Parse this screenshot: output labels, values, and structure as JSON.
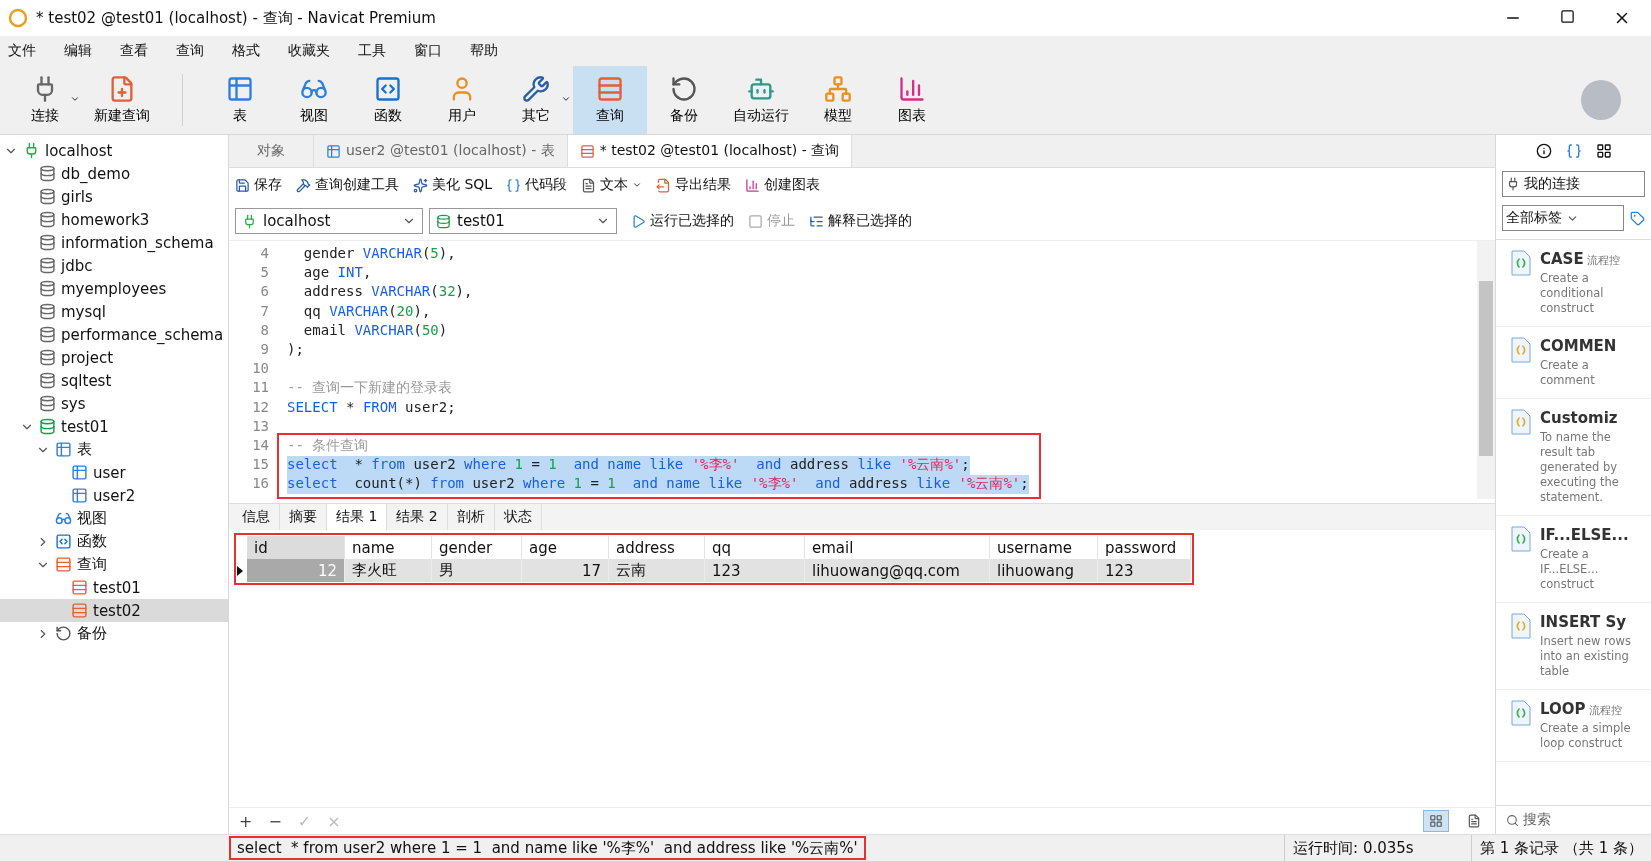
{
  "window": {
    "title": "* test02 @test01 (localhost) - 查询 - Navicat Premium"
  },
  "menu": [
    "文件",
    "编辑",
    "查看",
    "查询",
    "格式",
    "收藏夹",
    "工具",
    "窗口",
    "帮助"
  ],
  "toolbar": [
    {
      "label": "连接",
      "dropdown": true,
      "selected": false
    },
    {
      "label": "新建查询",
      "dropdown": false,
      "selected": false
    },
    {
      "label": "表",
      "dropdown": false,
      "selected": false
    },
    {
      "label": "视图",
      "dropdown": false,
      "selected": false
    },
    {
      "label": "函数",
      "dropdown": false,
      "selected": false
    },
    {
      "label": "用户",
      "dropdown": false,
      "selected": false
    },
    {
      "label": "其它",
      "dropdown": true,
      "selected": false
    },
    {
      "label": "查询",
      "dropdown": false,
      "selected": true
    },
    {
      "label": "备份",
      "dropdown": false,
      "selected": false
    },
    {
      "label": "自动运行",
      "dropdown": false,
      "selected": false
    },
    {
      "label": "模型",
      "dropdown": false,
      "selected": false
    },
    {
      "label": "图表",
      "dropdown": false,
      "selected": false
    }
  ],
  "sidebar": {
    "items": [
      {
        "label": "localhost",
        "kind": "connection",
        "expanded": true,
        "selected": false,
        "children": [
          {
            "label": "db_demo",
            "kind": "database",
            "selected": false
          },
          {
            "label": "girls",
            "kind": "database",
            "selected": false
          },
          {
            "label": "homework3",
            "kind": "database",
            "selected": false
          },
          {
            "label": "information_schema",
            "kind": "database",
            "selected": false
          },
          {
            "label": "jdbc",
            "kind": "database",
            "selected": false
          },
          {
            "label": "myemployees",
            "kind": "database",
            "selected": false
          },
          {
            "label": "mysql",
            "kind": "database",
            "selected": false
          },
          {
            "label": "performance_schema",
            "kind": "database",
            "selected": false
          },
          {
            "label": "project",
            "kind": "database",
            "selected": false
          },
          {
            "label": "sqltest",
            "kind": "database",
            "selected": false
          },
          {
            "label": "sys",
            "kind": "database",
            "selected": false
          },
          {
            "label": "test01",
            "kind": "opendatabase",
            "expanded": true,
            "selected": false,
            "children": [
              {
                "label": "表",
                "kind": "table",
                "expanded": true,
                "selected": false,
                "children": [
                  {
                    "label": "user",
                    "kind": "table",
                    "selected": false
                  },
                  {
                    "label": "user2",
                    "kind": "table",
                    "selected": false
                  }
                ]
              },
              {
                "label": "视图",
                "kind": "view",
                "selected": false
              },
              {
                "label": "函数",
                "kind": "function",
                "expanded": false,
                "selected": false
              },
              {
                "label": "查询",
                "kind": "query",
                "expanded": true,
                "selected": false,
                "children": [
                  {
                    "label": "test01",
                    "kind": "query",
                    "selected": false
                  },
                  {
                    "label": "test02",
                    "kind": "query",
                    "selected": true
                  }
                ]
              },
              {
                "label": "备份",
                "kind": "backup",
                "expanded": false,
                "selected": false
              }
            ]
          }
        ]
      }
    ]
  },
  "tabs": [
    {
      "label": "对象",
      "selected": false
    },
    {
      "label": "user2 @test01 (localhost) - 表",
      "selected": false
    },
    {
      "label": "* test02 @test01 (localhost) - 查询",
      "selected": true
    }
  ],
  "query_toolbar": [
    {
      "label": "保存",
      "dropdown": false
    },
    {
      "label": "查询创建工具",
      "dropdown": false
    },
    {
      "label": "美化 SQL",
      "dropdown": false
    },
    {
      "label": "代码段",
      "dropdown": false
    },
    {
      "label": "文本",
      "dropdown": true
    },
    {
      "label": "导出结果",
      "dropdown": false
    },
    {
      "label": "创建图表",
      "dropdown": false
    }
  ],
  "connection_select": {
    "value": "localhost"
  },
  "database_select": {
    "value": "test01"
  },
  "run_actions": [
    {
      "label": "运行已选择的",
      "disabled": false
    },
    {
      "label": "停止",
      "disabled": true
    },
    {
      "label": "解释已选择的",
      "disabled": false
    }
  ],
  "editor": {
    "highlighted": true,
    "lines": [
      {
        "number": "4",
        "selected": false,
        "tokens": [
          {
            "kind": "plain",
            "text": "  gender "
          },
          {
            "kind": "keyword",
            "text": "VARCHAR"
          },
          {
            "kind": "plain",
            "text": "("
          },
          {
            "kind": "number",
            "text": "5"
          },
          {
            "kind": "plain",
            "text": "),"
          }
        ]
      },
      {
        "number": "5",
        "selected": false,
        "tokens": [
          {
            "kind": "plain",
            "text": "  age "
          },
          {
            "kind": "keyword",
            "text": "INT"
          },
          {
            "kind": "plain",
            "text": ","
          }
        ]
      },
      {
        "number": "6",
        "selected": false,
        "tokens": [
          {
            "kind": "plain",
            "text": "  address "
          },
          {
            "kind": "keyword",
            "text": "VARCHAR"
          },
          {
            "kind": "plain",
            "text": "("
          },
          {
            "kind": "number",
            "text": "32"
          },
          {
            "kind": "plain",
            "text": "),"
          }
        ]
      },
      {
        "number": "7",
        "selected": false,
        "tokens": [
          {
            "kind": "plain",
            "text": "  qq "
          },
          {
            "kind": "keyword",
            "text": "VARCHAR"
          },
          {
            "kind": "plain",
            "text": "("
          },
          {
            "kind": "number",
            "text": "20"
          },
          {
            "kind": "plain",
            "text": "),"
          }
        ]
      },
      {
        "number": "8",
        "selected": false,
        "tokens": [
          {
            "kind": "plain",
            "text": "  email "
          },
          {
            "kind": "keyword",
            "text": "VARCHAR"
          },
          {
            "kind": "plain",
            "text": "("
          },
          {
            "kind": "number",
            "text": "50"
          },
          {
            "kind": "plain",
            "text": ")"
          }
        ]
      },
      {
        "number": "9",
        "selected": false,
        "tokens": [
          {
            "kind": "plain",
            "text": ");"
          }
        ]
      },
      {
        "number": "10",
        "selected": false
      },
      {
        "number": "11",
        "selected": false,
        "tokens": [
          {
            "kind": "comment",
            "text": "-- 查询一下新建的登录表"
          }
        ]
      },
      {
        "number": "12",
        "selected": false,
        "tokens": [
          {
            "kind": "keyword",
            "text": "SELECT"
          },
          {
            "kind": "plain",
            "text": " * "
          },
          {
            "kind": "keyword",
            "text": "FROM"
          },
          {
            "kind": "plain",
            "text": " user2;"
          }
        ]
      },
      {
        "number": "13",
        "selected": false
      },
      {
        "number": "14",
        "selected": false,
        "tokens": [
          {
            "kind": "comment",
            "text": "-- 条件查询"
          }
        ]
      },
      {
        "number": "15",
        "selected": true,
        "tokens": [
          {
            "kind": "keyword",
            "text": "select"
          },
          {
            "kind": "plain",
            "text": "  * "
          },
          {
            "kind": "keyword",
            "text": "from"
          },
          {
            "kind": "plain",
            "text": " user2 "
          },
          {
            "kind": "keyword",
            "text": "where"
          },
          {
            "kind": "number",
            "text": " 1"
          },
          {
            "kind": "plain",
            "text": " = "
          },
          {
            "kind": "number",
            "text": "1"
          },
          {
            "kind": "keyword",
            "text": "  and"
          },
          {
            "kind": "keyword",
            "text": " name"
          },
          {
            "kind": "keyword",
            "text": " like"
          },
          {
            "kind": "string",
            "text": " '%李%'"
          },
          {
            "kind": "keyword",
            "text": "  and"
          },
          {
            "kind": "plain",
            "text": " address "
          },
          {
            "kind": "keyword",
            "text": "like"
          },
          {
            "kind": "string",
            "text": " '%云南%'"
          },
          {
            "kind": "plain",
            "text": ";"
          }
        ]
      },
      {
        "number": "16",
        "selected": true,
        "tokens": [
          {
            "kind": "keyword",
            "text": "select"
          },
          {
            "kind": "plain",
            "text": "  count(*) "
          },
          {
            "kind": "keyword",
            "text": "from"
          },
          {
            "kind": "plain",
            "text": " user2 "
          },
          {
            "kind": "keyword",
            "text": "where"
          },
          {
            "kind": "number",
            "text": " 1"
          },
          {
            "kind": "plain",
            "text": " = "
          },
          {
            "kind": "number",
            "text": "1"
          },
          {
            "kind": "keyword",
            "text": "  and"
          },
          {
            "kind": "keyword",
            "text": " name"
          },
          {
            "kind": "keyword",
            "text": " like"
          },
          {
            "kind": "string",
            "text": " '%李%'"
          },
          {
            "kind": "keyword",
            "text": "  and"
          },
          {
            "kind": "plain",
            "text": " address "
          },
          {
            "kind": "keyword",
            "text": "like"
          },
          {
            "kind": "string",
            "text": " '%云南%'"
          },
          {
            "kind": "plain",
            "text": ";"
          }
        ]
      }
    ]
  },
  "result_tabs": [
    {
      "label": "信息",
      "selected": false
    },
    {
      "label": "摘要",
      "selected": false
    },
    {
      "label": "结果 1",
      "selected": true
    },
    {
      "label": "结果 2",
      "selected": false
    },
    {
      "label": "剖析",
      "selected": false
    },
    {
      "label": "状态",
      "selected": false
    }
  ],
  "table": {
    "highlighted": true,
    "columns": [
      "id",
      "name",
      "gender",
      "age",
      "address",
      "qq",
      "email",
      "username",
      "password"
    ],
    "rows": [
      {
        "selected": true,
        "cells": [
          "12",
          "李火旺",
          "男",
          "17",
          "云南",
          "123",
          "lihuowang@qq.com",
          "lihuowang",
          "123"
        ]
      }
    ]
  },
  "grid_actions": [
    {
      "label": "+",
      "disabled": false
    },
    {
      "label": "−",
      "disabled": false
    },
    {
      "label": "✓",
      "disabled": true
    },
    {
      "label": "×",
      "disabled": true
    }
  ],
  "view_modes": [
    {
      "selected": true
    },
    {
      "selected": false
    }
  ],
  "status_bar": {
    "sql": "select  * from user2 where 1 = 1  and name like '%李%'  and address like '%云南%'",
    "sql_highlighted": true,
    "time": "运行时间: 0.035s",
    "records": "第 1 条记录 （共 1 条）"
  },
  "right_panel": {
    "connection_filter": "我的连接",
    "tag_filter": "全部标签",
    "search_placeholder": "搜索",
    "snippets": [
      {
        "title": "CASE",
        "tag": "流程控",
        "description": "Create a conditional construct",
        "color": "#3cb44b"
      },
      {
        "title": "COMMEN",
        "description": "Create a comment",
        "color": "#e8b020"
      },
      {
        "title": "Customiz",
        "description": "To name the result tab generated by executing the statement.",
        "color": "#e8b020"
      },
      {
        "title": "IF...ELSE...",
        "description": "Create a IF...ELSE... construct",
        "color": "#3cb44b"
      },
      {
        "title": "INSERT Sy",
        "description": "Insert new rows into an existing table",
        "color": "#e8b020"
      },
      {
        "title": "LOOP",
        "tag": "流程控",
        "description": "Create a simple loop construct",
        "color": "#3cb44b"
      }
    ]
  }
}
